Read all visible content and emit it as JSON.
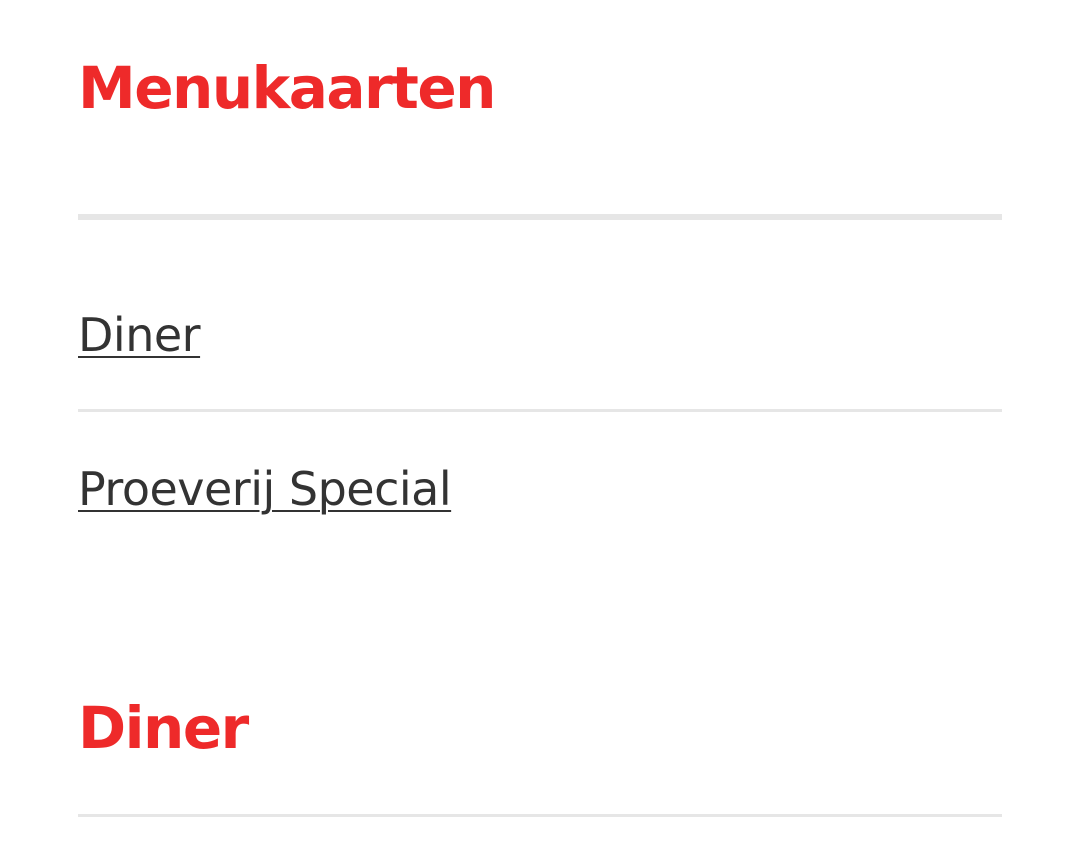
{
  "section": {
    "title": "Menukaarten",
    "menus": [
      {
        "label": "Diner"
      },
      {
        "label": "Proeverij Special"
      }
    ]
  },
  "menu_section": {
    "title": "Diner"
  },
  "colors": {
    "heading": "#ee2a2a",
    "link": "#333333",
    "divider": "#e6e6e6"
  }
}
